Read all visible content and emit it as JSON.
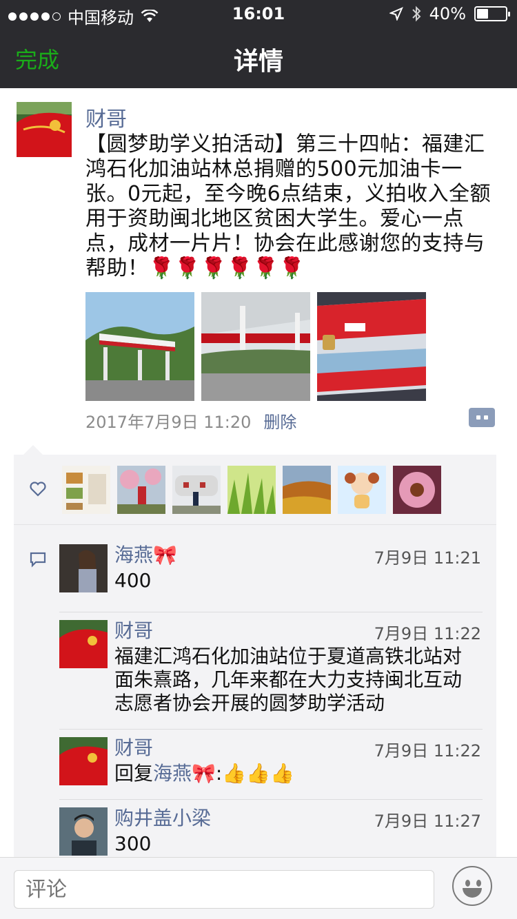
{
  "status_bar": {
    "carrier": "中国移动",
    "time": "16:01",
    "battery": "40%",
    "battery_level": 0.4
  },
  "nav": {
    "done_label": "完成",
    "title": "详情"
  },
  "post": {
    "author": "财哥",
    "text": "【圆梦助学义拍活动】第三十四帖：福建汇鸿石化加油站林总捐赠的500元加油卡一张。0元起，至今晚6点结束，义拍收入全额用于资助闽北地区贫困大学生。爱心一点点，成材一片片！协会在此感谢您的支持与帮助！🌹🌹🌹🌹🌹🌹",
    "timestamp": "2017年7月9日 11:20",
    "delete_label": "删除",
    "photo_count": 3
  },
  "likes": {
    "count": 7
  },
  "comments": [
    {
      "name": "海燕🎀",
      "time": "7月9日 11:21",
      "text": "400"
    },
    {
      "name": "财哥",
      "time": "7月9日 11:22",
      "text": "福建汇鸿石化加油站位于夏道高铁北站对面朱熹路，几年来都在大力支持闽北互动志愿者协会开展的圆梦助学活动"
    },
    {
      "name": "财哥",
      "time": "7月9日 11:22",
      "reply_prefix": "回复",
      "reply_to": "海燕🎀",
      "reply_text": ":👍👍👍"
    },
    {
      "name": "购井盖小梁",
      "time": "7月9日 11:27",
      "text": "300"
    }
  ],
  "input": {
    "placeholder": "评论"
  },
  "colors": {
    "nav_bg": "#2b2b2f",
    "done_green": "#1aad19",
    "link_blue": "#576b95",
    "panel_bg": "#f3f3f5"
  }
}
